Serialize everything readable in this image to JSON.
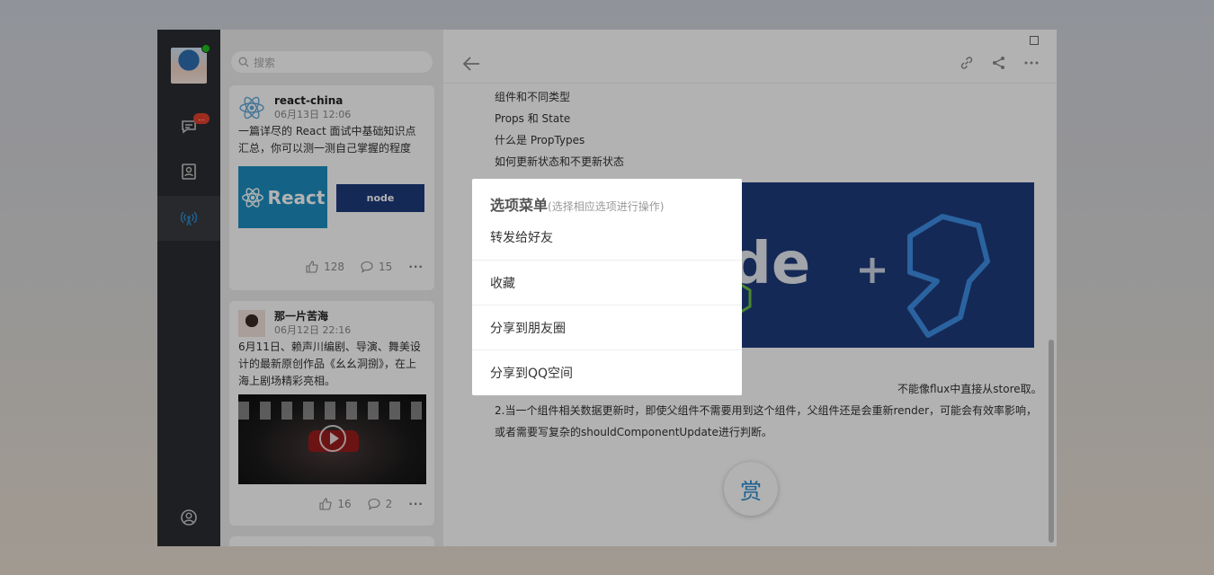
{
  "nav": {
    "chat_badge": "..."
  },
  "search": {
    "placeholder": "搜索"
  },
  "feed": [
    {
      "user": "react-china",
      "time": "06月13日 12:06",
      "text": "一篇详尽的 React 面试中基础知识点汇总，你可以测一测自己掌握的程度",
      "image1_text": "React",
      "image2_text": "node",
      "likes": "128",
      "comments": "15"
    },
    {
      "user": "那一片苦海",
      "time": "06月12日 22:16",
      "text": "6月11日、赖声川编剧、导演、舞美设计的最新原创作品《幺幺洞捌》，在上海上剧场精彩亮相。",
      "likes": "16",
      "comments": "2"
    }
  ],
  "article": {
    "lines": [
      "组件和不同类型",
      "Props 和 State",
      "什么是 PropTypes",
      "如何更新状态和不更新状态"
    ],
    "para1_tail": "不能像flux中直接从store取。",
    "para2_line1": "2.当一个组件相关数据更新时，即使父组件不需要用到这个组件，父组件还是会重新render，可能会有效率影响，",
    "para2_line2": "或者需要写复杂的shouldComponentUpdate进行判断。",
    "reward_label": "赏"
  },
  "menu": {
    "title": "选项菜单",
    "subtitle": "(选择相应选项进行操作)",
    "items": [
      "转发给好友",
      "收藏",
      "分享到朋友圈",
      "分享到QQ空间"
    ]
  },
  "colors": {
    "nav_bg": "#2b2d31",
    "accent": "#2b8ccf",
    "badge": "#e2412f",
    "online": "#1fc21f"
  }
}
